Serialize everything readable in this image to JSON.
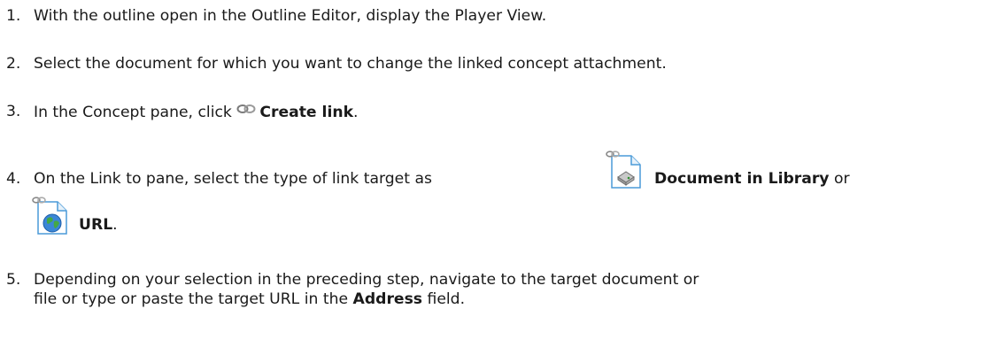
{
  "steps": [
    {
      "number": "1.",
      "text": "With the outline open in the Outline Editor, display the Player View."
    },
    {
      "number": "2.",
      "text": "Select the document for which you want to change the linked concept attachment."
    },
    {
      "number": "3.",
      "text_before": "In the Concept pane, click ",
      "link_icon": "chain-link-icon",
      "bold": "Create link",
      "text_after": "."
    },
    {
      "number": "4.",
      "text_before": "On the Link to pane, select the type of link target as ",
      "option1_icon": "linked-document-library-icon",
      "option1_bold": "Document in Library",
      "connector": " or",
      "option2_icon": "linked-url-globe-icon",
      "option2_bold": "URL",
      "text_after": "."
    },
    {
      "number": "5.",
      "line1": "Depending on your selection in the preceding step, navigate to the target document or",
      "line2_before": "file or type or paste the target URL in the ",
      "bold": "Address",
      "line2_after": " field."
    }
  ]
}
